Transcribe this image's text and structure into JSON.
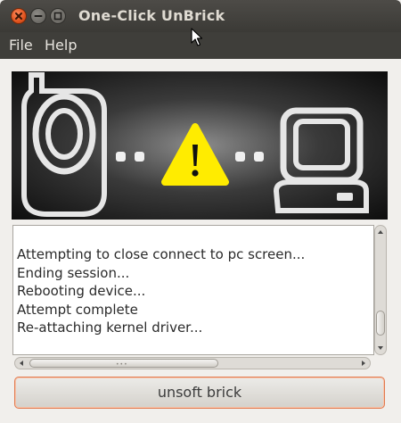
{
  "window": {
    "title": "One-Click UnBrick"
  },
  "titlebar_buttons": {
    "close_icon": "close-icon",
    "minimize_icon": "minimize-icon",
    "maximize_icon": "maximize-icon"
  },
  "menu": {
    "items": [
      {
        "label": "File"
      },
      {
        "label": "Help"
      }
    ]
  },
  "banner": {
    "left_icon": "mobile-phone-icon",
    "center_icon": "warning-icon",
    "right_icon": "computer-icon",
    "warning_color": "#ffec00"
  },
  "log": {
    "lines": [
      "Attempting to close connect to pc screen...",
      "Ending session...",
      "Rebooting device...",
      "Attempt complete",
      "Re-attaching kernel driver..."
    ]
  },
  "action": {
    "label": "unsoft brick"
  },
  "colors": {
    "titlebar": "#3f3e3a",
    "close_button": "#e0531e",
    "button_focus_border": "#e27a4f"
  }
}
